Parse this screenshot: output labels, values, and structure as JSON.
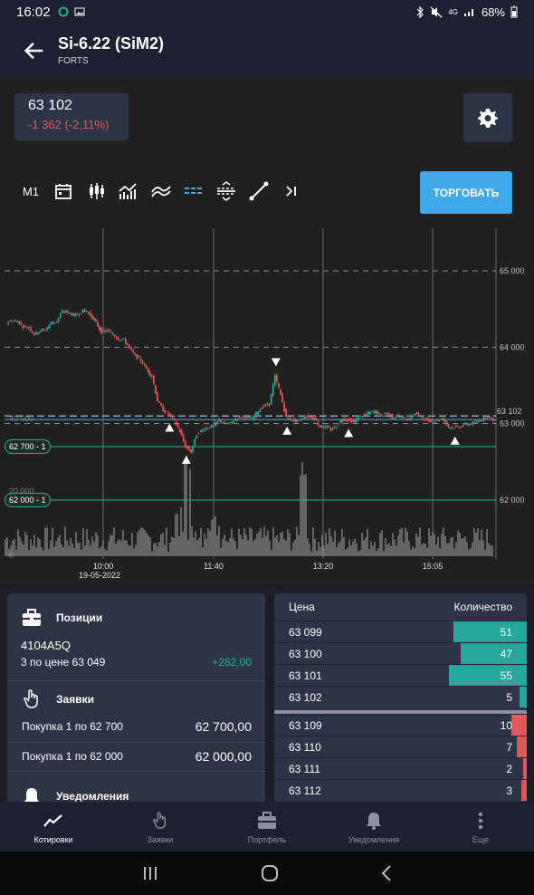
{
  "status_bar": {
    "time": "16:02",
    "network": "4G",
    "battery": "68%"
  },
  "app_bar": {
    "title": "Si-6.22 (SiM2)",
    "subtitle": "FORTS"
  },
  "quote": {
    "price": "63 102",
    "change": "-1 362 (-2,11%)"
  },
  "toolbar": {
    "timeframe": "M1",
    "trade_button": "ТОРГОВАТЬ"
  },
  "chart_data": {
    "type": "candlestick",
    "y_ticks": [
      "65 000",
      "64 000",
      "63 000",
      "62 000"
    ],
    "current_price_label": "63 102",
    "volume_ticks": [
      "40 000",
      "20 000",
      "0"
    ],
    "x_labels": [
      "10:00",
      "11:40",
      "13:20",
      "15:05"
    ],
    "date_label": "19-05-2022",
    "price_range": [
      61300,
      65800
    ],
    "price_path": [
      64330,
      64350,
      64340,
      64270,
      64260,
      64170,
      64220,
      64230,
      64320,
      64340,
      64470,
      64460,
      64420,
      64440,
      64490,
      64420,
      64320,
      64200,
      64220,
      64170,
      64110,
      64100,
      63990,
      63890,
      63830,
      63720,
      63620,
      63300,
      63180,
      63120,
      63040,
      62900,
      62700,
      62630,
      62860,
      62920,
      62950,
      62970,
      63050,
      63000,
      63000,
      63070,
      63090,
      63080,
      63070,
      63170,
      63230,
      63260,
      63620,
      63380,
      63080,
      63050,
      63030,
      63080,
      63100,
      63070,
      62960,
      62960,
      62920,
      62970,
      63060,
      63050,
      63020,
      63090,
      63110,
      63150,
      63160,
      63110,
      63140,
      63080,
      63100,
      63070,
      63060,
      63140,
      63090,
      63050,
      63030,
      63050,
      63060,
      62960,
      62950,
      62960,
      62990,
      63000,
      63020,
      63060,
      63100,
      63050
    ],
    "levels": [
      {
        "label": "62 700 - 1",
        "price": 62700
      },
      {
        "label": "62 000 - 1",
        "price": 62000
      }
    ],
    "trade_markers": [
      {
        "direction": "up",
        "time_index": 29
      },
      {
        "direction": "up",
        "time_index": 32
      },
      {
        "direction": "down",
        "time_index": 48
      },
      {
        "direction": "up",
        "time_index": 50
      },
      {
        "direction": "up",
        "time_index": 61
      },
      {
        "direction": "up",
        "time_index": 80
      }
    ]
  },
  "positions": {
    "title": "Позиции",
    "account": "4104A5Q",
    "detail": "3 по цене 63 049",
    "pl": "+282,00"
  },
  "orders": {
    "title": "Заявки",
    "rows": [
      {
        "desc": "Покупка  1  по  62 700",
        "value": "62 700,00"
      },
      {
        "desc": "Покупка  1  по  62 000",
        "value": "62 000,00"
      }
    ]
  },
  "alerts": {
    "title": "Уведомления"
  },
  "order_book": {
    "price_header": "Цена",
    "qty_header": "Количество",
    "bids": [
      {
        "price": "63 099",
        "qty": "51",
        "fill": 0.29
      },
      {
        "price": "63 100",
        "qty": "47",
        "fill": 0.26
      },
      {
        "price": "63 101",
        "qty": "55",
        "fill": 0.31
      },
      {
        "price": "63 102",
        "qty": "5",
        "fill": 0.03
      }
    ],
    "asks": [
      {
        "price": "63 109",
        "qty": "10",
        "fill": 0.06
      },
      {
        "price": "63 110",
        "qty": "7",
        "fill": 0.04
      },
      {
        "price": "63 111",
        "qty": "2",
        "fill": 0.01
      },
      {
        "price": "63 112",
        "qty": "3",
        "fill": 0.02
      }
    ]
  },
  "bottom_nav": [
    {
      "label": "Котировки",
      "active": true
    },
    {
      "label": "Заявки",
      "active": false
    },
    {
      "label": "Портфель",
      "active": false
    },
    {
      "label": "Уведомления",
      "active": false
    },
    {
      "label": "Еще",
      "active": false
    }
  ],
  "colors": {
    "up": "#26a69a",
    "down": "#e4565a",
    "accent": "#3fa9e8",
    "panel": "#2d3446"
  }
}
